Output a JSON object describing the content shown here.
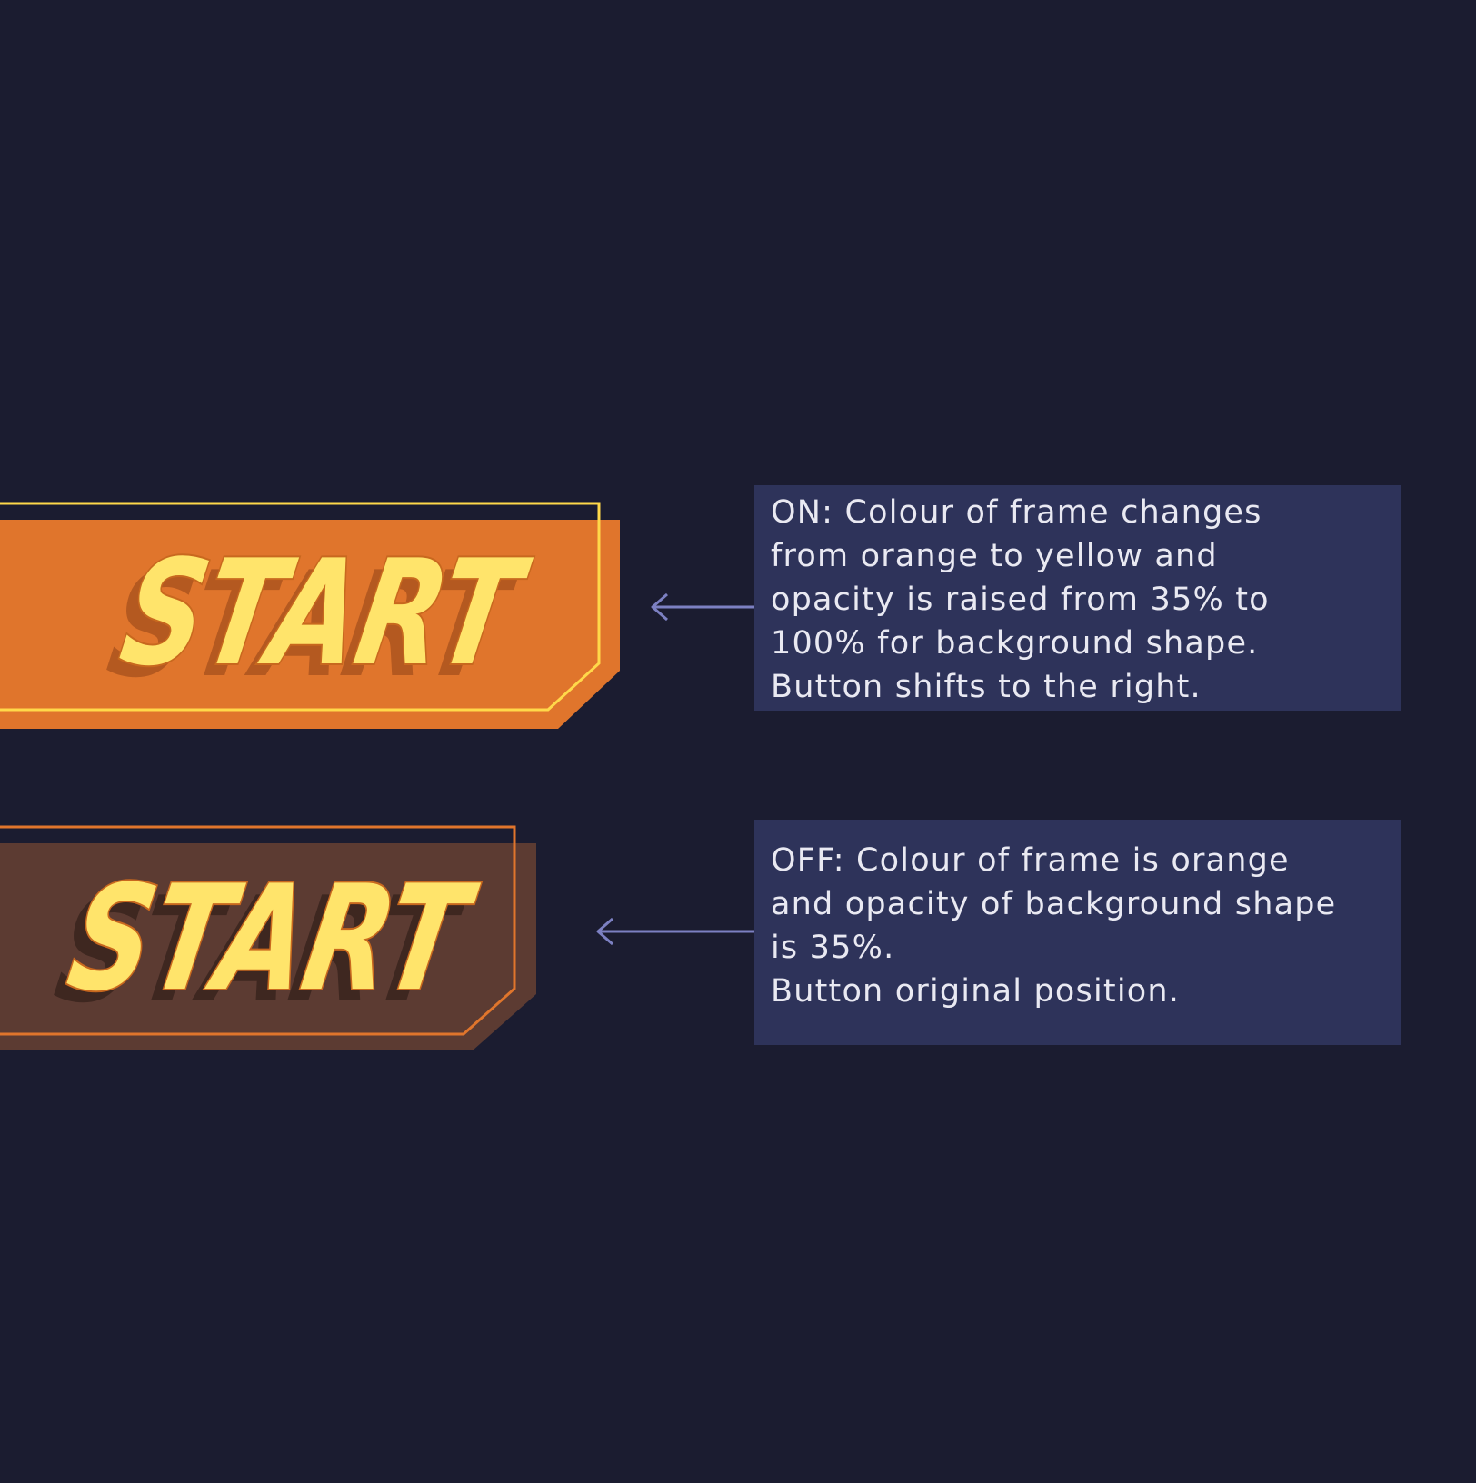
{
  "colors": {
    "background": "#1b1c30",
    "note_background": "#2e335a",
    "note_text": "#e9e9f2",
    "arrow": "#7c80c2",
    "on_shape": "#e0752c",
    "on_frame": "#ffd84a",
    "off_shape": "#5c3b32",
    "off_frame": "#e0752c",
    "label_fill": "#ffe46b",
    "label_stroke": "#c8681e"
  },
  "buttons": {
    "on": {
      "state": "ON",
      "label": "START",
      "background_opacity_percent": 100
    },
    "off": {
      "state": "OFF",
      "label": "START",
      "background_opacity_percent": 35
    }
  },
  "notes": {
    "on": {
      "lines": [
        "ON: Colour of frame changes",
        "from orange to yellow and",
        "opacity is raised from 35% to",
        "100% for background shape.",
        "Button shifts to the right."
      ]
    },
    "off": {
      "lines": [
        "OFF: Colour of frame is orange",
        "and opacity of background shape",
        "is 35%.",
        "Button original position."
      ]
    }
  },
  "icons": {
    "on_arrow": "arrow-left-icon",
    "off_arrow": "arrow-left-icon"
  }
}
